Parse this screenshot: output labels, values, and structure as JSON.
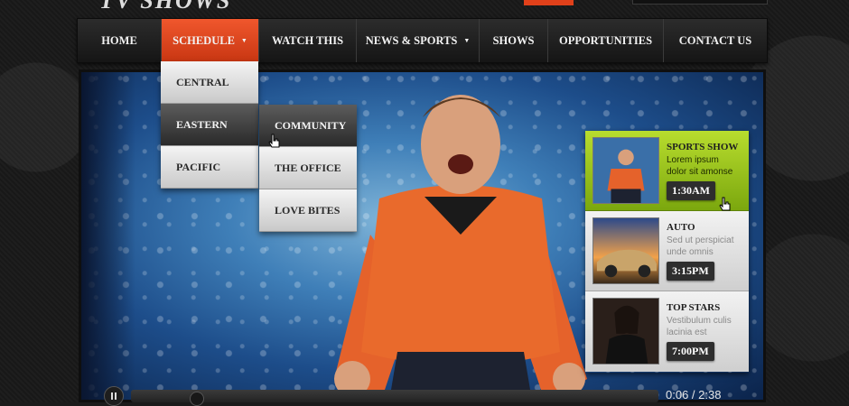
{
  "brand": {
    "logo_text": "TV SHOWS"
  },
  "nav": {
    "items": [
      {
        "label": "HOME"
      },
      {
        "label": "SCHEDULE"
      },
      {
        "label": "WATCH THIS"
      },
      {
        "label": "NEWS & SPORTS"
      },
      {
        "label": "SHOWS"
      },
      {
        "label": "OPPORTUNITIES"
      },
      {
        "label": "CONTACT US"
      }
    ],
    "active": "SCHEDULE",
    "accent_color": "#e34a22"
  },
  "schedule_menu": {
    "items": [
      {
        "label": "CENTRAL"
      },
      {
        "label": "EASTERN"
      },
      {
        "label": "PACIFIC"
      }
    ]
  },
  "eastern_menu": {
    "items": [
      {
        "label": "COMMUNITY"
      },
      {
        "label": "THE OFFICE"
      },
      {
        "label": "LOVE BITES"
      }
    ]
  },
  "sidebar": {
    "cards": [
      {
        "title": "SPORTS SHOW",
        "desc": "Lorem ipsum dolor sit amonse",
        "time": "1:30AM",
        "featured": true,
        "accent": "#9ccb1f"
      },
      {
        "title": "AUTO",
        "desc": "Sed ut perspiciat unde omnis",
        "time": "3:15PM"
      },
      {
        "title": "TOP STARS",
        "desc": "Vestibulum culis lacinia est",
        "time": "7:00PM"
      }
    ]
  },
  "player": {
    "current_time": "0:06",
    "separator": " / ",
    "duration": "2:38",
    "progress": 0.04
  }
}
